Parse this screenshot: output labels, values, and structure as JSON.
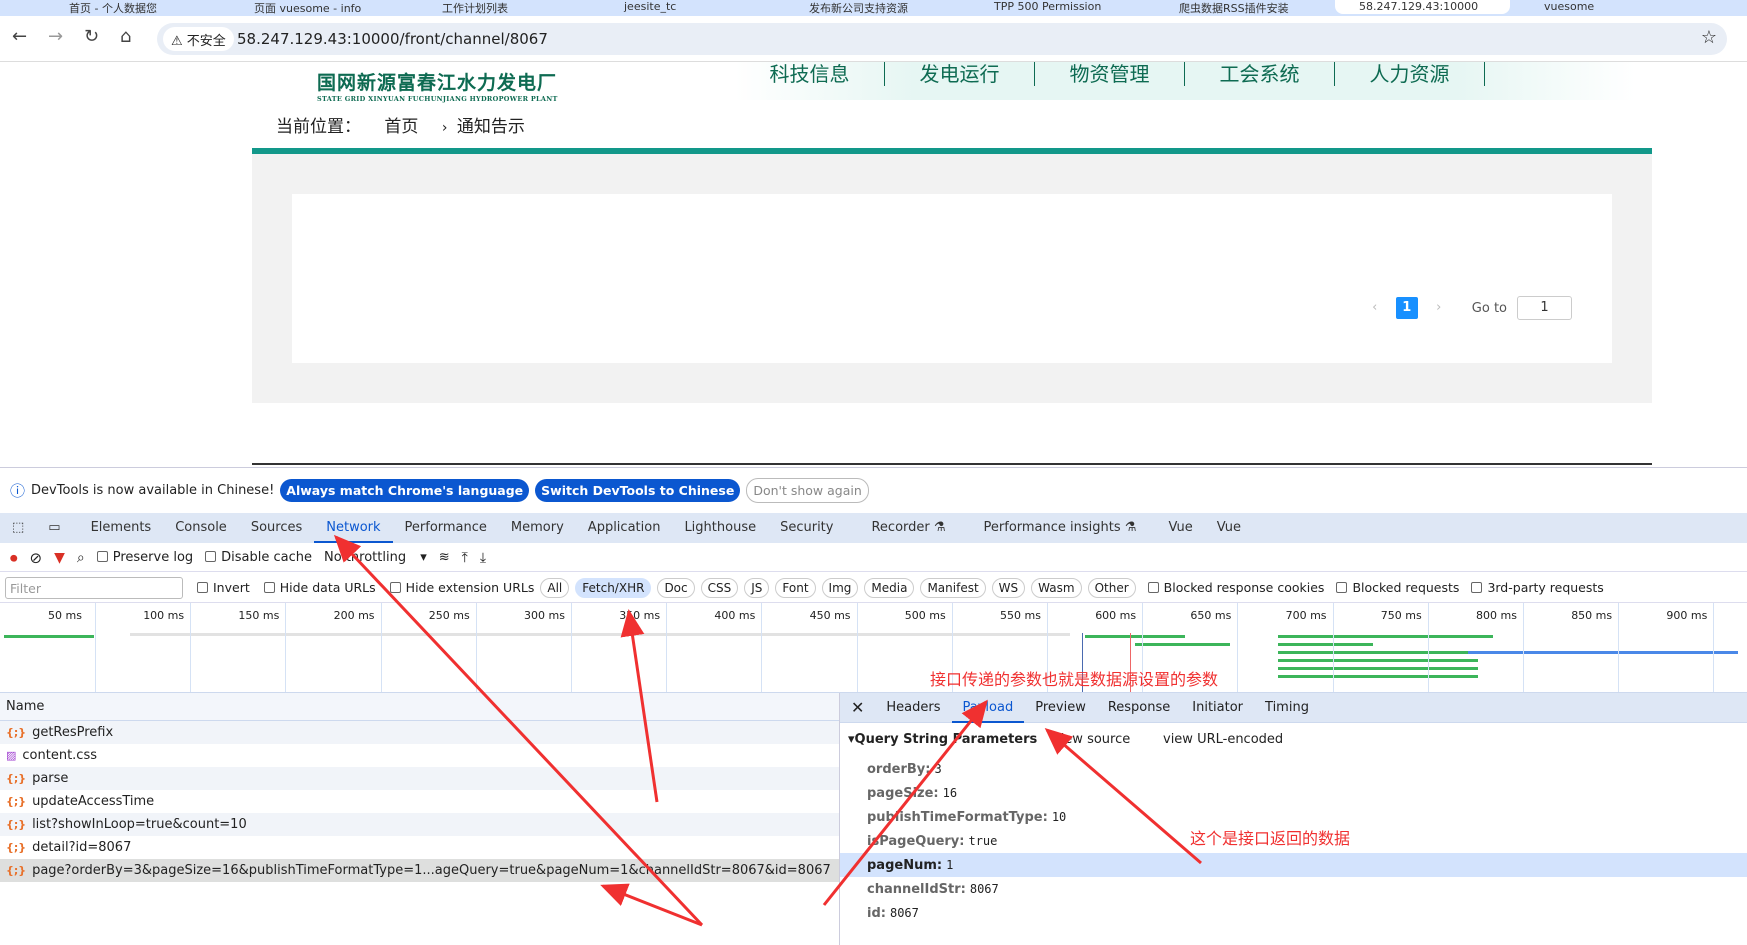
{
  "browser": {
    "tabs": [
      "首页 - 个人数据您",
      "页面 vuesome - info",
      "工作计划列表",
      "jeesite_tc",
      "发布新公司支持资源",
      "TPP 500 Permission",
      "爬虫数据RSS插件安装",
      "58.247.129.43:10000",
      "vuesome"
    ],
    "security_label": "不安全",
    "url": "58.247.129.43:10000/front/channel/8067"
  },
  "site": {
    "logo_cn": "国网新源富春江水力发电厂",
    "logo_en": "STATE GRID XINYUAN FUCHUNJIANG HYDROPOWER PLANT",
    "nav": [
      "科技信息",
      "发电运行",
      "物资管理",
      "工会系统",
      "人力资源"
    ],
    "breadcrumb": {
      "label": "当前位置：",
      "home": "首页",
      "sep": "›",
      "current": "通知告示"
    },
    "pager": {
      "prev": "‹",
      "current": "1",
      "next": "›",
      "goto_label": "Go to",
      "goto_value": "1"
    }
  },
  "devtools": {
    "infobar": {
      "text": "DevTools is now available in Chinese!",
      "btn1": "Always match Chrome's language",
      "btn2": "Switch DevTools to Chinese",
      "btn3": "Don't show again"
    },
    "tabs": [
      "Elements",
      "Console",
      "Sources",
      "Network",
      "Performance",
      "Memory",
      "Application",
      "Lighthouse",
      "Security",
      "Recorder ⚗",
      "Performance insights ⚗",
      "Vue",
      "Vue"
    ],
    "toolbar": {
      "preserve_log": "Preserve log",
      "disable_cache": "Disable cache",
      "throttling": "No throttling"
    },
    "filter": {
      "placeholder": "Filter",
      "invert": "Invert",
      "hide_data": "Hide data URLs",
      "hide_ext": "Hide extension URLs",
      "types": [
        "All",
        "Fetch/XHR",
        "Doc",
        "CSS",
        "JS",
        "Font",
        "Img",
        "Media",
        "Manifest",
        "WS",
        "Wasm",
        "Other"
      ],
      "blocked_cookies": "Blocked response cookies",
      "blocked_requests": "Blocked requests",
      "third_party": "3rd-party requests"
    },
    "timeline_ticks": [
      "50 ms",
      "100 ms",
      "150 ms",
      "200 ms",
      "250 ms",
      "300 ms",
      "350 ms",
      "400 ms",
      "450 ms",
      "500 ms",
      "550 ms",
      "600 ms",
      "650 ms",
      "700 ms",
      "750 ms",
      "800 ms",
      "850 ms",
      "900 ms"
    ],
    "list_header": "Name",
    "requests": [
      "getResPrefix",
      "content.css",
      "parse",
      "updateAccessTime",
      "list?showInLoop=true&count=10",
      "detail?id=8067",
      "page?orderBy=3&pageSize=16&publishTimeFormatType=1...ageQuery=true&pageNum=1&channelIdStr=8067&id=8067"
    ],
    "detail_tabs": [
      "Headers",
      "Payload",
      "Preview",
      "Response",
      "Initiator",
      "Timing"
    ],
    "payload": {
      "section": "Query String Parameters",
      "view_source": "view source",
      "view_encoded": "view URL-encoded",
      "params": [
        {
          "k": "orderBy:",
          "v": "3"
        },
        {
          "k": "pageSize:",
          "v": "16"
        },
        {
          "k": "publishTimeFormatType:",
          "v": "10"
        },
        {
          "k": "isPageQuery:",
          "v": "true"
        },
        {
          "k": "pageNum:",
          "v": "1"
        },
        {
          "k": "channelIdStr:",
          "v": "8067"
        },
        {
          "k": "id:",
          "v": "8067"
        }
      ]
    }
  },
  "annotations": {
    "note1": "接口传递的参数也就是数据源设置的参数",
    "note2": "这个是接口返回的数据",
    "color": "#f03030"
  }
}
